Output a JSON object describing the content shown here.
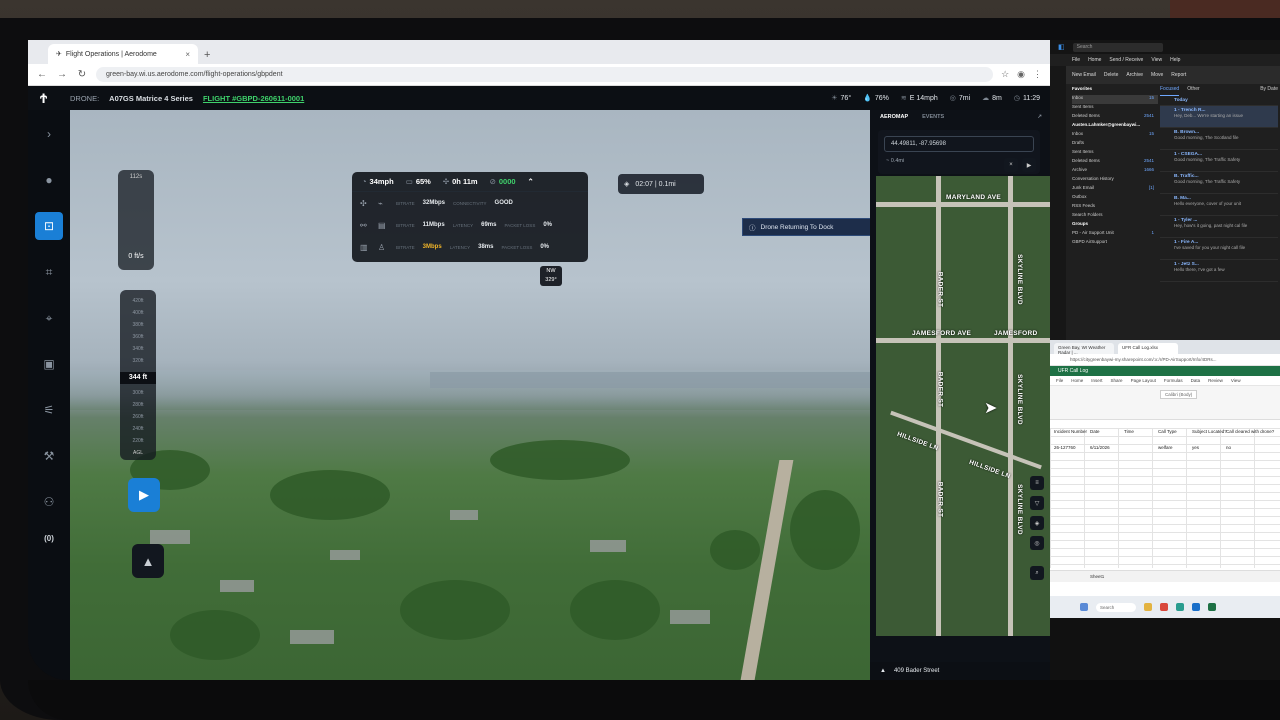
{
  "browser": {
    "tab_title": "Flight Operations | Aerodome",
    "url": "green-bay.wi.us.aerodome.com/flight-operations/gbpdent"
  },
  "app": {
    "drone_label": "DRONE:",
    "drone_name": "A07GS Matrice 4 Series",
    "flight_label": "FLIGHT #GBPD-260611-0001",
    "stats": [
      {
        "icon": "sun-icon",
        "value": "76°"
      },
      {
        "icon": "humidity-icon",
        "value": "76%"
      },
      {
        "icon": "wind-icon",
        "value": "E 14mph"
      },
      {
        "icon": "visibility-icon",
        "value": "7mi"
      },
      {
        "icon": "cloud-icon",
        "value": "8m"
      },
      {
        "icon": "clock-icon",
        "value": "11:29"
      }
    ]
  },
  "sidebar": {
    "count": "(0)"
  },
  "video": {
    "speed_top": "112s",
    "speed_value": "0 ft/s",
    "altitude_ticks": [
      "420ft",
      "400ft",
      "380ft",
      "360ft",
      "340ft",
      "320ft",
      "300ft",
      "280ft",
      "260ft",
      "240ft",
      "220ft",
      "200ft"
    ],
    "altitude_current": "344 ft",
    "altitude_foot": "AGL",
    "heading_dir": "NW",
    "heading_deg": "329°",
    "telemetry": {
      "speed": "34mph",
      "battery": "65%",
      "flight_time": "0h 11m",
      "signal": "0000",
      "rows": [
        {
          "k1": "BITRATE",
          "v1": "32Mbps",
          "k2": "CONNECTIVITY",
          "v2": "GOOD",
          "k3": "",
          "v3": ""
        },
        {
          "k1": "BITRATE",
          "v1": "11Mbps",
          "k2": "LATENCY",
          "v2": "69ms",
          "k3": "PACKET LOSS",
          "v3": "0%"
        },
        {
          "k1": "BITRATE",
          "v1": "3Mbps",
          "k2": "LATENCY",
          "v2": "38ms",
          "k3": "PACKET LOSS",
          "v3": "0%"
        }
      ]
    },
    "timer": "02:07 | 0.1mi",
    "status_banner": "Drone Returning To Dock"
  },
  "map": {
    "tabs": [
      "AEROMAP",
      "EVENTS"
    ],
    "coords": "44.49811, -87.95698",
    "sub_text": "~ 0.4mi",
    "streets": [
      "MARYLAND AVE",
      "JAMESFORD AVE",
      "JAMESFORD",
      "HILLSIDE LN",
      "HILLSIDE LN",
      "SKYLINE BLVD",
      "SKYLINE BLVD",
      "SKYLINE BLVD",
      "BADER ST",
      "BADER ST",
      "BADER ST"
    ],
    "address": "409 Bader Street"
  },
  "outlook": {
    "search": "Search",
    "menu": [
      "File",
      "Home",
      "Send / Receive",
      "View",
      "Help"
    ],
    "ribbon": [
      "New Email",
      "Delete",
      "Archive",
      "Move",
      "Report"
    ],
    "folders": [
      {
        "label": "Favorites",
        "count": "",
        "type": "hdr"
      },
      {
        "label": "Inbox",
        "count": "15",
        "type": "sel"
      },
      {
        "label": "Sent Items",
        "count": "",
        "type": ""
      },
      {
        "label": "Deleted Items",
        "count": "2541",
        "type": ""
      },
      {
        "label": "Austen.Lahmker@greenbaywi...",
        "count": "",
        "type": "hdr"
      },
      {
        "label": "Inbox",
        "count": "15",
        "type": ""
      },
      {
        "label": "Drafts",
        "count": "",
        "type": ""
      },
      {
        "label": "Sent Items",
        "count": "",
        "type": ""
      },
      {
        "label": "Deleted Items",
        "count": "2541",
        "type": ""
      },
      {
        "label": "Archive",
        "count": "1666",
        "type": ""
      },
      {
        "label": "Conversation History",
        "count": "",
        "type": ""
      },
      {
        "label": "Junk Email",
        "count": "[1]",
        "type": ""
      },
      {
        "label": "Outbox",
        "count": "",
        "type": ""
      },
      {
        "label": "RSS Feeds",
        "count": "",
        "type": ""
      },
      {
        "label": "Search Folders",
        "count": "",
        "type": ""
      },
      {
        "label": "Groups",
        "count": "",
        "type": "hdr"
      },
      {
        "label": "PD - Air Support Unit",
        "count": "1",
        "type": ""
      },
      {
        "label": "GBPD AirSupport",
        "count": "",
        "type": ""
      }
    ],
    "list_tabs": [
      "Focused",
      "Other",
      "By Date"
    ],
    "messages": [
      {
        "from": "Today",
        "snippet": "",
        "sel": false
      },
      {
        "from": "1 - Trench R...",
        "snippet": "Hey, Deb... We're starting an issue",
        "sel": true
      },
      {
        "from": "B. Brown...",
        "snippet": "Good morning, The Scotland file",
        "sel": false
      },
      {
        "from": "1 - CSEGA...",
        "snippet": "Good morning, The Traffic Safety",
        "sel": false
      },
      {
        "from": "B. Traffic...",
        "snippet": "Good morning, The Traffic Safety",
        "sel": false
      },
      {
        "from": "B. Ma...",
        "snippet": "Hello everyone, cover of your unit",
        "sel": false
      },
      {
        "from": "1 - Tyler ...",
        "snippet": "Hey, how's it going, past night cal file",
        "sel": false
      },
      {
        "from": "1 - Fire A...",
        "snippet": "I've saved for you your night call file",
        "sel": false
      },
      {
        "from": "1 - Jetz S...",
        "snippet": "Hello there, I've got a few",
        "sel": false
      }
    ]
  },
  "excel": {
    "tabs": [
      "Green Bay, WI Weather Radar | ...",
      "UFR Call Log.xlsx"
    ],
    "url": "https://citygreenbaywi-my.sharepoint.com/:x:/r/PD-AirSupport/Info/4DRs...",
    "app_title": "UFR Call Log",
    "menu": [
      "File",
      "Home",
      "Insert",
      "Share",
      "Page Layout",
      "Formulas",
      "Data",
      "Review",
      "View"
    ],
    "font": "Calibri (Body)",
    "headers": [
      "Incident Number",
      "Date",
      "Time",
      "Call Type",
      "Subject Located?",
      "Call cleared with drone?"
    ],
    "row": [
      "26-127760",
      "6/11/2026",
      "",
      "welfare",
      "yes",
      "no"
    ],
    "sheet": "Sheet1",
    "taskbar_search": "Search"
  }
}
